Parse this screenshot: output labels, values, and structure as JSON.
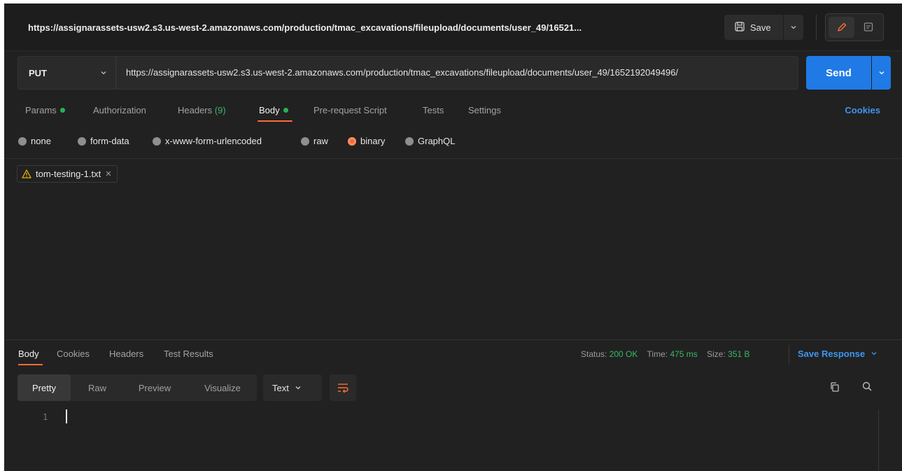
{
  "titlebar": {
    "url": "https://assignarassets-usw2.s3.us-west-2.amazonaws.com/production/tmac_excavations/fileupload/documents/user_49/16521...",
    "save_label": "Save"
  },
  "request": {
    "method": "PUT",
    "url": "https://assignarassets-usw2.s3.us-west-2.amazonaws.com/production/tmac_excavations/fileupload/documents/user_49/1652192049496/",
    "send_label": "Send"
  },
  "tabs": {
    "params": "Params",
    "authorization": "Authorization",
    "headers": "Headers",
    "headers_count": "(9)",
    "body": "Body",
    "pre_request": "Pre-request Script",
    "tests": "Tests",
    "settings": "Settings",
    "cookies": "Cookies"
  },
  "body_modes": {
    "none": "none",
    "form_data": "form-data",
    "urlencoded": "x-www-form-urlencoded",
    "raw": "raw",
    "binary": "binary",
    "graphql": "GraphQL",
    "selected": "binary"
  },
  "file": {
    "name": "tom-testing-1.txt"
  },
  "response": {
    "tabs": {
      "body": "Body",
      "cookies": "Cookies",
      "headers": "Headers",
      "test_results": "Test Results"
    },
    "status_label": "Status:",
    "status_value": "200 OK",
    "time_label": "Time:",
    "time_value": "475 ms",
    "size_label": "Size:",
    "size_value": "351 B",
    "save_response": "Save Response",
    "views": {
      "pretty": "Pretty",
      "raw": "Raw",
      "preview": "Preview",
      "visualize": "Visualize"
    },
    "format": "Text",
    "line_number": "1"
  },
  "colors": {
    "accent_orange": "#ff6c37",
    "send_blue": "#1f7ae6",
    "link_blue": "#3d96f2",
    "status_green": "#3ab866"
  }
}
